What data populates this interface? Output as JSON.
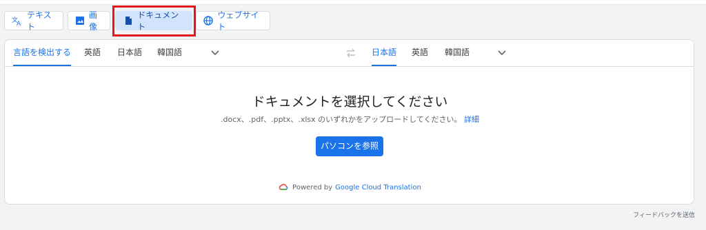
{
  "modes": [
    {
      "label": "テキスト",
      "icon": "translate-icon"
    },
    {
      "label": "画像",
      "icon": "image-icon"
    },
    {
      "label": "ドキュメント",
      "icon": "document-icon",
      "active": true
    },
    {
      "label": "ウェブサイト",
      "icon": "globe-icon"
    }
  ],
  "source_langs": [
    "言語を検出する",
    "英語",
    "日本語",
    "韓国語"
  ],
  "target_langs": [
    "日本語",
    "英語",
    "日本語",
    "韓国語"
  ],
  "main": {
    "title": "ドキュメントを選択してください",
    "subtitle": ".docx、.pdf、.pptx、.xlsx のいずれかをアップロードしてください。",
    "details_link": "詳細",
    "browse_button": "パソコンを参照",
    "powered_by": "Powered by",
    "powered_service": "Google Cloud Translation"
  },
  "feedback": "フィードバックを送信",
  "colors": {
    "accent": "#1a73e8",
    "highlight": "#e3161b",
    "active_bg": "#d2e3fc"
  }
}
